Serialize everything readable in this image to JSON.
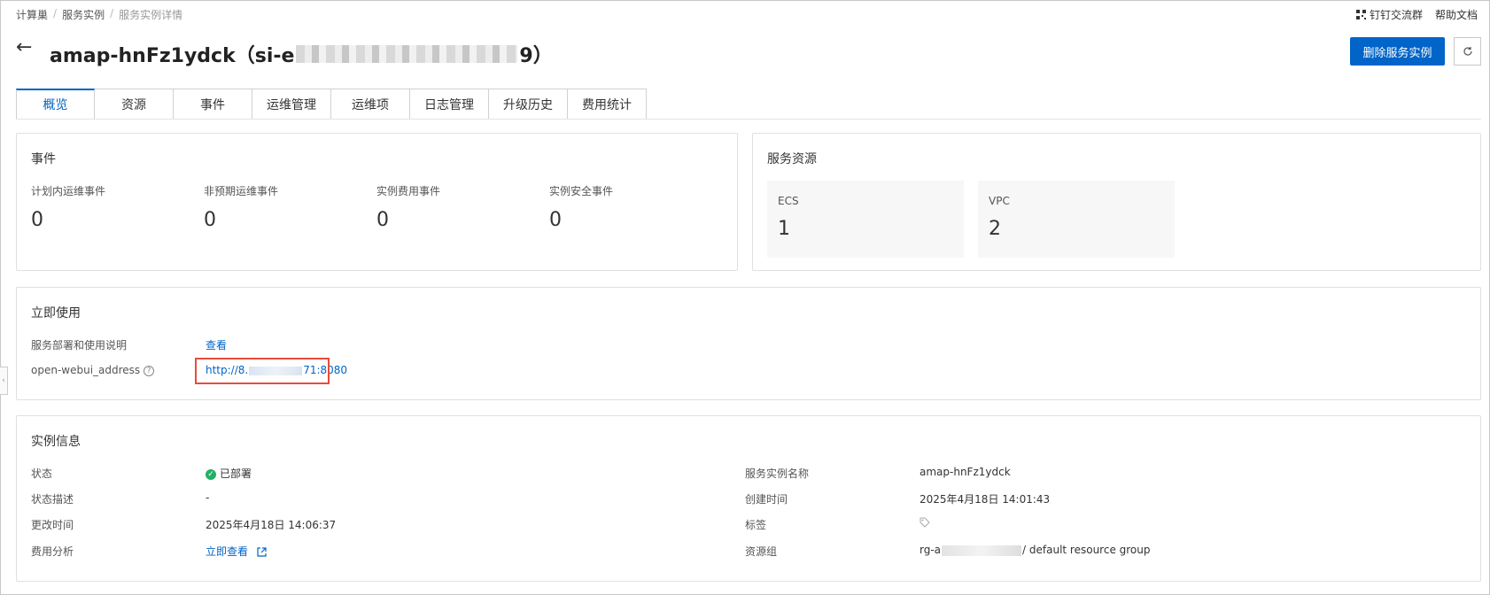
{
  "breadcrumb": {
    "items": [
      "计算巢",
      "服务实例",
      "服务实例详情"
    ]
  },
  "top_links": {
    "dingtalk": "钉钉交流群",
    "help": "帮助文档"
  },
  "header": {
    "title_prefix": "amap-hnFz1ydck（si-e",
    "title_suffix": "9）",
    "delete_label": "删除服务实例"
  },
  "tabs": [
    "概览",
    "资源",
    "事件",
    "运维管理",
    "运维项",
    "日志管理",
    "升级历史",
    "费用统计"
  ],
  "events": {
    "title": "事件",
    "items": [
      {
        "label": "计划内运维事件",
        "value": "0"
      },
      {
        "label": "非预期运维事件",
        "value": "0"
      },
      {
        "label": "实例费用事件",
        "value": "0"
      },
      {
        "label": "实例安全事件",
        "value": "0"
      }
    ]
  },
  "resources": {
    "title": "服务资源",
    "items": [
      {
        "label": "ECS",
        "value": "1"
      },
      {
        "label": "VPC",
        "value": "2"
      }
    ]
  },
  "use_now": {
    "title": "立即使用",
    "doc_label": "服务部署和使用说明",
    "doc_link": "查看",
    "addr_label": "open-webui_address",
    "addr_prefix": "http://8.",
    "addr_suffix": "71:8080"
  },
  "instance_info": {
    "title": "实例信息",
    "status_label": "状态",
    "status_value": "已部署",
    "desc_label": "状态描述",
    "desc_value": "-",
    "mtime_label": "更改时间",
    "mtime_value": "2025年4月18日 14:06:37",
    "cost_label": "费用分析",
    "cost_link": "立即查看",
    "name_label": "服务实例名称",
    "name_value": "amap-hnFz1ydck",
    "ctime_label": "创建时间",
    "ctime_value": "2025年4月18日 14:01:43",
    "tag_label": "标签",
    "rg_label": "资源组",
    "rg_prefix": "rg-a",
    "rg_suffix": "/ default resource group"
  },
  "colors": {
    "primary": "#0064c8",
    "success": "#23b066",
    "highlight": "#e74c3c"
  }
}
